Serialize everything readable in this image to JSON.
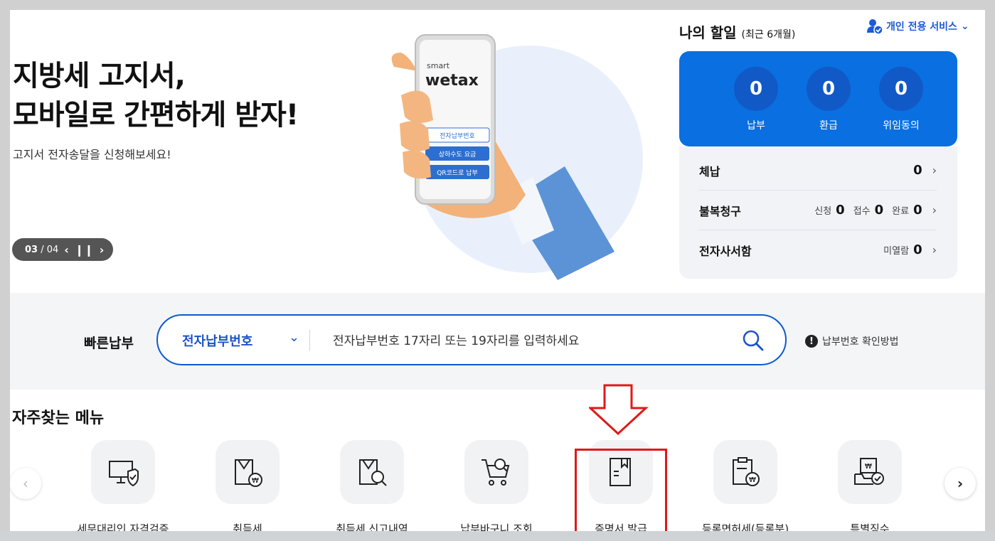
{
  "hero": {
    "title_line1": "지방세 고지서,",
    "title_line2": "모바일로 간편하게 받자!",
    "subtitle": "고지서 전자송달을 신청해보세요!",
    "pager_current": "03",
    "pager_total": "/ 04",
    "phone": {
      "brand_small": "smart",
      "brand": "wetax",
      "btn1": "전자납부번호",
      "btn2": "상하수도 요금",
      "btn3": "QR코드로 납부"
    }
  },
  "todo": {
    "title": "나의 할일",
    "period": "(최근 6개월)",
    "personal_service": "개인 전용 서비스",
    "stats": [
      {
        "value": "0",
        "label": "납부"
      },
      {
        "value": "0",
        "label": "환급"
      },
      {
        "value": "0",
        "label": "위임동의"
      }
    ],
    "rows": {
      "arrears": {
        "name": "체납",
        "value": "0"
      },
      "appeal": {
        "name": "불복청구",
        "applied_label": "신청",
        "applied": "0",
        "received_label": "접수",
        "received": "0",
        "done_label": "완료",
        "done": "0"
      },
      "mailbox": {
        "name": "전자사서함",
        "unread_label": "미열람",
        "unread": "0"
      }
    }
  },
  "quick_pay": {
    "label": "빠른납부",
    "selected_option": "전자납부번호",
    "placeholder": "전자납부번호 17자리 또는 19자리를 입력하세요",
    "help": "납부번호 확인방법"
  },
  "menu": {
    "title": "자주찾는 메뉴",
    "items": [
      {
        "label": "세무대리인 자격검증",
        "icon": "monitor-shield-icon"
      },
      {
        "label": "취득세",
        "icon": "document-won-icon"
      },
      {
        "label": "취득세 신고내역",
        "icon": "document-search-icon"
      },
      {
        "label": "납부바구니 조회",
        "icon": "cart-search-icon"
      },
      {
        "label": "증명서 발급",
        "icon": "certificate-icon"
      },
      {
        "label": "등록면허세(등록분)",
        "icon": "clipboard-won-icon"
      },
      {
        "label": "특별징수",
        "icon": "tray-check-icon"
      }
    ]
  },
  "colors": {
    "accent": "#0a6fe0",
    "highlight": "#e01919"
  }
}
